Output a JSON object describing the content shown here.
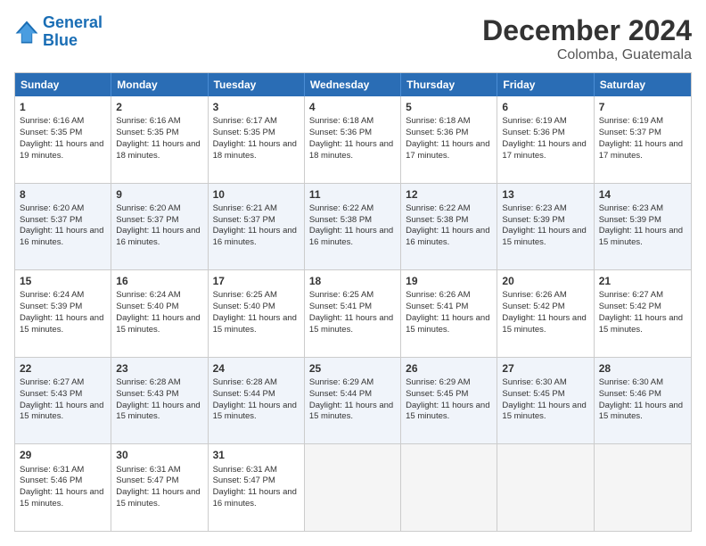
{
  "logo": {
    "line1": "General",
    "line2": "Blue"
  },
  "title": "December 2024",
  "subtitle": "Colomba, Guatemala",
  "days_of_week": [
    "Sunday",
    "Monday",
    "Tuesday",
    "Wednesday",
    "Thursday",
    "Friday",
    "Saturday"
  ],
  "weeks": [
    [
      {
        "day": 1,
        "sunrise": "6:16 AM",
        "sunset": "5:35 PM",
        "daylight": "11 hours and 19 minutes."
      },
      {
        "day": 2,
        "sunrise": "6:16 AM",
        "sunset": "5:35 PM",
        "daylight": "11 hours and 18 minutes."
      },
      {
        "day": 3,
        "sunrise": "6:17 AM",
        "sunset": "5:35 PM",
        "daylight": "11 hours and 18 minutes."
      },
      {
        "day": 4,
        "sunrise": "6:18 AM",
        "sunset": "5:36 PM",
        "daylight": "11 hours and 18 minutes."
      },
      {
        "day": 5,
        "sunrise": "6:18 AM",
        "sunset": "5:36 PM",
        "daylight": "11 hours and 17 minutes."
      },
      {
        "day": 6,
        "sunrise": "6:19 AM",
        "sunset": "5:36 PM",
        "daylight": "11 hours and 17 minutes."
      },
      {
        "day": 7,
        "sunrise": "6:19 AM",
        "sunset": "5:37 PM",
        "daylight": "11 hours and 17 minutes."
      }
    ],
    [
      {
        "day": 8,
        "sunrise": "6:20 AM",
        "sunset": "5:37 PM",
        "daylight": "11 hours and 16 minutes."
      },
      {
        "day": 9,
        "sunrise": "6:20 AM",
        "sunset": "5:37 PM",
        "daylight": "11 hours and 16 minutes."
      },
      {
        "day": 10,
        "sunrise": "6:21 AM",
        "sunset": "5:37 PM",
        "daylight": "11 hours and 16 minutes."
      },
      {
        "day": 11,
        "sunrise": "6:22 AM",
        "sunset": "5:38 PM",
        "daylight": "11 hours and 16 minutes."
      },
      {
        "day": 12,
        "sunrise": "6:22 AM",
        "sunset": "5:38 PM",
        "daylight": "11 hours and 16 minutes."
      },
      {
        "day": 13,
        "sunrise": "6:23 AM",
        "sunset": "5:39 PM",
        "daylight": "11 hours and 15 minutes."
      },
      {
        "day": 14,
        "sunrise": "6:23 AM",
        "sunset": "5:39 PM",
        "daylight": "11 hours and 15 minutes."
      }
    ],
    [
      {
        "day": 15,
        "sunrise": "6:24 AM",
        "sunset": "5:39 PM",
        "daylight": "11 hours and 15 minutes."
      },
      {
        "day": 16,
        "sunrise": "6:24 AM",
        "sunset": "5:40 PM",
        "daylight": "11 hours and 15 minutes."
      },
      {
        "day": 17,
        "sunrise": "6:25 AM",
        "sunset": "5:40 PM",
        "daylight": "11 hours and 15 minutes."
      },
      {
        "day": 18,
        "sunrise": "6:25 AM",
        "sunset": "5:41 PM",
        "daylight": "11 hours and 15 minutes."
      },
      {
        "day": 19,
        "sunrise": "6:26 AM",
        "sunset": "5:41 PM",
        "daylight": "11 hours and 15 minutes."
      },
      {
        "day": 20,
        "sunrise": "6:26 AM",
        "sunset": "5:42 PM",
        "daylight": "11 hours and 15 minutes."
      },
      {
        "day": 21,
        "sunrise": "6:27 AM",
        "sunset": "5:42 PM",
        "daylight": "11 hours and 15 minutes."
      }
    ],
    [
      {
        "day": 22,
        "sunrise": "6:27 AM",
        "sunset": "5:43 PM",
        "daylight": "11 hours and 15 minutes."
      },
      {
        "day": 23,
        "sunrise": "6:28 AM",
        "sunset": "5:43 PM",
        "daylight": "11 hours and 15 minutes."
      },
      {
        "day": 24,
        "sunrise": "6:28 AM",
        "sunset": "5:44 PM",
        "daylight": "11 hours and 15 minutes."
      },
      {
        "day": 25,
        "sunrise": "6:29 AM",
        "sunset": "5:44 PM",
        "daylight": "11 hours and 15 minutes."
      },
      {
        "day": 26,
        "sunrise": "6:29 AM",
        "sunset": "5:45 PM",
        "daylight": "11 hours and 15 minutes."
      },
      {
        "day": 27,
        "sunrise": "6:30 AM",
        "sunset": "5:45 PM",
        "daylight": "11 hours and 15 minutes."
      },
      {
        "day": 28,
        "sunrise": "6:30 AM",
        "sunset": "5:46 PM",
        "daylight": "11 hours and 15 minutes."
      }
    ],
    [
      {
        "day": 29,
        "sunrise": "6:31 AM",
        "sunset": "5:46 PM",
        "daylight": "11 hours and 15 minutes."
      },
      {
        "day": 30,
        "sunrise": "6:31 AM",
        "sunset": "5:47 PM",
        "daylight": "11 hours and 15 minutes."
      },
      {
        "day": 31,
        "sunrise": "6:31 AM",
        "sunset": "5:47 PM",
        "daylight": "11 hours and 16 minutes."
      },
      null,
      null,
      null,
      null
    ]
  ]
}
